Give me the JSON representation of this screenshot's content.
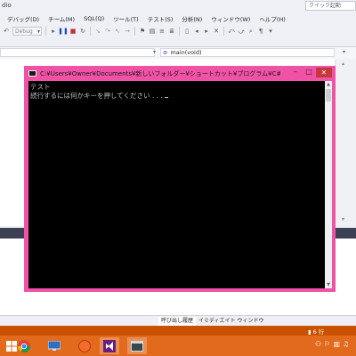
{
  "vs": {
    "title_fragment": "dio",
    "quick_launch_placeholder": "クイック起動",
    "menu": [
      "デバッグ(D)",
      "チーム(M)",
      "SQL(Q)",
      "ツール(T)",
      "テスト(S)",
      "分析(N)",
      "ウィンドウ(W)",
      "ヘルプ(H)"
    ],
    "toolbar": {
      "config_combo": "Debug"
    },
    "nav": {
      "function": "main(void)"
    },
    "tabs": {
      "call_stack": "呼び出し履歴",
      "immediate": "イミディエイト ウィンドウ"
    },
    "status": {
      "line": "6 行"
    }
  },
  "console": {
    "title": "C:¥Users¥Owner¥Documents¥新しいフォルダー¥ショートカット¥プログラム¥C#¥P...",
    "lines": [
      "テスト",
      "続行するには何かキーを押してください . . ."
    ],
    "frame_color": "#f052a6"
  },
  "taskbar": {
    "apps": [
      "start",
      "chrome",
      "remote-desktop",
      "orange-app",
      "visual-studio",
      "console-window"
    ],
    "accent": "#e26a1c"
  }
}
